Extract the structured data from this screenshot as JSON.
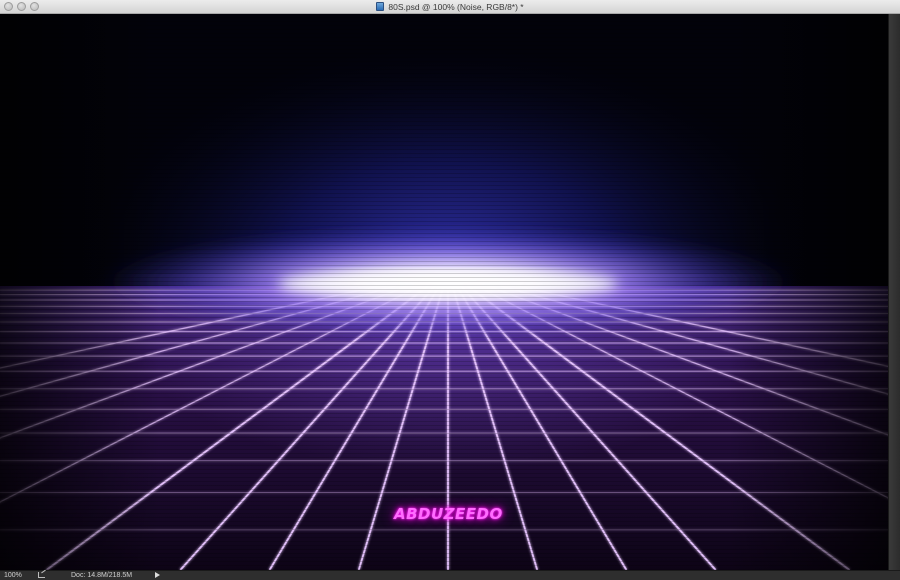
{
  "window": {
    "title": "80S.psd @ 100% (Noise, RGB/8*) *"
  },
  "canvas": {
    "logo_text": "ABDUZEEDO",
    "colors": {
      "glow_core": "#ffffff",
      "glow_mid": "#8c6dff",
      "glow_outer": "#23258f",
      "grid_line": "#e7c4ff",
      "floor": "#1c0a2c",
      "logo": "#ff2bff"
    }
  },
  "statusbar": {
    "zoom": "100%",
    "doc_size": "Doc: 14.8M/218.5M"
  },
  "icons": {
    "document": "psd-document-icon",
    "export": "share-export-icon",
    "menu": "triangle-right-icon"
  }
}
